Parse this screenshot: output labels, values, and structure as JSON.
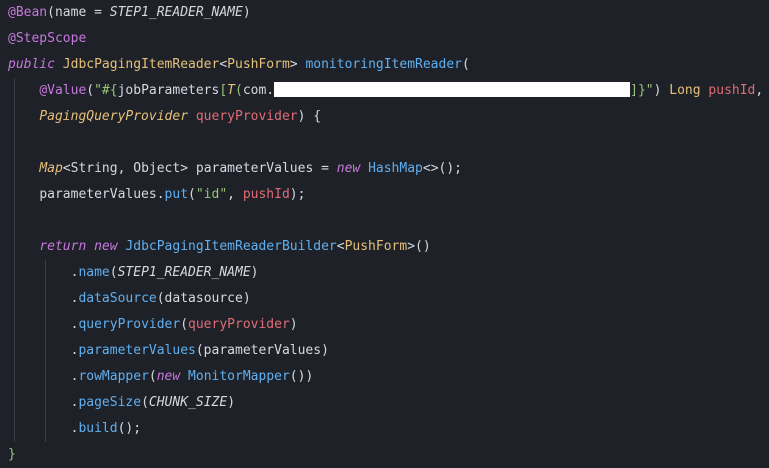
{
  "colors": {
    "background": "#1e2127",
    "annotation": "#c678dd",
    "keyword": "#c678dd",
    "type": "#e5c07b",
    "method": "#61afef",
    "param": "#e06c75",
    "string": "#98c379",
    "constant": "#e5c07b",
    "plain": "#d5d9e0",
    "brace": "#98c379",
    "indent_guide": "#3b4048"
  },
  "code": {
    "lines": [
      {
        "tokens": [
          {
            "t": "@Bean",
            "c": "annotation"
          },
          {
            "t": "(name = ",
            "c": "plain"
          },
          {
            "t": "STEP1_READER_NAME",
            "c": "plain",
            "i": true
          },
          {
            "t": ")",
            "c": "plain"
          }
        ]
      },
      {
        "tokens": [
          {
            "t": "@StepScope",
            "c": "annotation"
          }
        ]
      },
      {
        "tokens": [
          {
            "t": "public",
            "c": "keyword",
            "i": true
          },
          {
            "t": " ",
            "c": "plain"
          },
          {
            "t": "JdbcPagingItemReader",
            "c": "type"
          },
          {
            "t": "<",
            "c": "plain"
          },
          {
            "t": "PushForm",
            "c": "type"
          },
          {
            "t": "> ",
            "c": "plain"
          },
          {
            "t": "monitoringItemReader",
            "c": "method"
          },
          {
            "t": "(",
            "c": "plain"
          }
        ]
      },
      {
        "tokens": [
          {
            "t": "    ",
            "c": "plain"
          },
          {
            "t": "@Value",
            "c": "annotation"
          },
          {
            "t": "(",
            "c": "plain"
          },
          {
            "t": "\"#{",
            "c": "string"
          },
          {
            "t": "jobParameters",
            "c": "plain"
          },
          {
            "t": "[",
            "c": "string"
          },
          {
            "t": "T",
            "c": "type",
            "i": true
          },
          {
            "t": "(",
            "c": "string"
          },
          {
            "t": "com.",
            "c": "plain"
          },
          {
            "redact": true
          },
          {
            "t": "]}\"",
            "c": "string"
          },
          {
            "t": ") ",
            "c": "plain"
          },
          {
            "t": "Long",
            "c": "type"
          },
          {
            "t": " ",
            "c": "plain"
          },
          {
            "t": "pushId",
            "c": "param"
          },
          {
            "t": ",",
            "c": "plain"
          }
        ]
      },
      {
        "tokens": [
          {
            "t": "    ",
            "c": "plain"
          },
          {
            "t": "PagingQueryProvider",
            "c": "type",
            "i": true
          },
          {
            "t": " ",
            "c": "plain"
          },
          {
            "t": "queryProvider",
            "c": "param"
          },
          {
            "t": ") {",
            "c": "plain"
          }
        ]
      },
      {
        "tokens": []
      },
      {
        "tokens": [
          {
            "t": "    ",
            "c": "plain"
          },
          {
            "t": "Map",
            "c": "type",
            "i": true
          },
          {
            "t": "<",
            "c": "plain"
          },
          {
            "t": "String",
            "c": "plain"
          },
          {
            "t": ", ",
            "c": "plain"
          },
          {
            "t": "Object",
            "c": "plain"
          },
          {
            "t": "> parameterValues = ",
            "c": "plain"
          },
          {
            "t": "new",
            "c": "keyword",
            "i": true
          },
          {
            "t": " ",
            "c": "plain"
          },
          {
            "t": "HashMap",
            "c": "method"
          },
          {
            "t": "<>();",
            "c": "plain"
          }
        ]
      },
      {
        "tokens": [
          {
            "t": "    ",
            "c": "plain"
          },
          {
            "t": "parameterValues.",
            "c": "plain"
          },
          {
            "t": "put",
            "c": "method"
          },
          {
            "t": "(",
            "c": "plain"
          },
          {
            "t": "\"id\"",
            "c": "string"
          },
          {
            "t": ", ",
            "c": "plain"
          },
          {
            "t": "pushId",
            "c": "param"
          },
          {
            "t": ");",
            "c": "plain"
          }
        ]
      },
      {
        "tokens": []
      },
      {
        "tokens": [
          {
            "t": "    ",
            "c": "plain"
          },
          {
            "t": "return",
            "c": "keyword",
            "i": true
          },
          {
            "t": " ",
            "c": "plain"
          },
          {
            "t": "new",
            "c": "keyword",
            "i": true
          },
          {
            "t": " ",
            "c": "plain"
          },
          {
            "t": "JdbcPagingItemReaderBuilder",
            "c": "method"
          },
          {
            "t": "<",
            "c": "plain"
          },
          {
            "t": "PushForm",
            "c": "type"
          },
          {
            "t": ">()",
            "c": "plain"
          }
        ]
      },
      {
        "tokens": [
          {
            "t": "        ",
            "c": "plain"
          },
          {
            "t": ".",
            "c": "plain"
          },
          {
            "t": "name",
            "c": "method"
          },
          {
            "t": "(",
            "c": "plain"
          },
          {
            "t": "STEP1_READER_NAME",
            "c": "plain",
            "i": true
          },
          {
            "t": ")",
            "c": "plain"
          }
        ]
      },
      {
        "tokens": [
          {
            "t": "        ",
            "c": "plain"
          },
          {
            "t": ".",
            "c": "plain"
          },
          {
            "t": "dataSource",
            "c": "method"
          },
          {
            "t": "(datasource)",
            "c": "plain"
          }
        ]
      },
      {
        "tokens": [
          {
            "t": "        ",
            "c": "plain"
          },
          {
            "t": ".",
            "c": "plain"
          },
          {
            "t": "queryProvider",
            "c": "method"
          },
          {
            "t": "(",
            "c": "plain"
          },
          {
            "t": "queryProvider",
            "c": "param"
          },
          {
            "t": ")",
            "c": "plain"
          }
        ]
      },
      {
        "tokens": [
          {
            "t": "        ",
            "c": "plain"
          },
          {
            "t": ".",
            "c": "plain"
          },
          {
            "t": "parameterValues",
            "c": "method"
          },
          {
            "t": "(parameterValues)",
            "c": "plain"
          }
        ]
      },
      {
        "tokens": [
          {
            "t": "        ",
            "c": "plain"
          },
          {
            "t": ".",
            "c": "plain"
          },
          {
            "t": "rowMapper",
            "c": "method"
          },
          {
            "t": "(",
            "c": "plain"
          },
          {
            "t": "new",
            "c": "keyword",
            "i": true
          },
          {
            "t": " ",
            "c": "plain"
          },
          {
            "t": "MonitorMapper",
            "c": "method"
          },
          {
            "t": "())",
            "c": "plain"
          }
        ]
      },
      {
        "tokens": [
          {
            "t": "        ",
            "c": "plain"
          },
          {
            "t": ".",
            "c": "plain"
          },
          {
            "t": "pageSize",
            "c": "method"
          },
          {
            "t": "(",
            "c": "plain"
          },
          {
            "t": "CHUNK_SIZE",
            "c": "plain",
            "i": true
          },
          {
            "t": ")",
            "c": "plain"
          }
        ]
      },
      {
        "tokens": [
          {
            "t": "        ",
            "c": "plain"
          },
          {
            "t": ".",
            "c": "plain"
          },
          {
            "t": "build",
            "c": "method"
          },
          {
            "t": "();",
            "c": "plain"
          }
        ]
      },
      {
        "tokens": [
          {
            "t": "}",
            "c": "brace"
          }
        ]
      }
    ]
  }
}
